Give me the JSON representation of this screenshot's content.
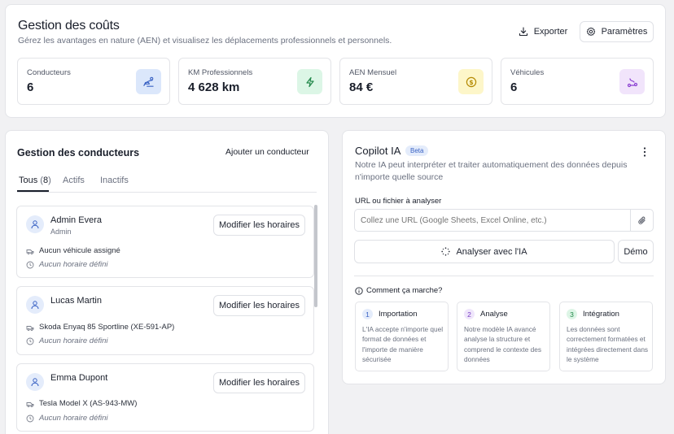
{
  "header": {
    "title": "Gestion des coûts",
    "subtitle": "Gérez les avantages en nature (AEN) et visualisez les déplacements professionnels et personnels.",
    "export_label": "Exporter",
    "settings_label": "Paramètres"
  },
  "stats": [
    {
      "label": "Conducteurs",
      "value": "6",
      "icon": "steering-wheel-icon",
      "color": "#dbe7fb"
    },
    {
      "label": "KM Professionnels",
      "value": "4 628 km",
      "icon": "lightning-icon",
      "color": "#dcf6e6"
    },
    {
      "label": "AEN Mensuel",
      "value": "84 €",
      "icon": "coin-icon",
      "color": "#fdf6c9"
    },
    {
      "label": "Véhicules",
      "value": "6",
      "icon": "route-icon",
      "color": "#f1e4fb"
    }
  ],
  "drivers_panel": {
    "title": "Gestion des conducteurs",
    "add_label": "Ajouter un conducteur",
    "tabs": [
      {
        "label": "Tous",
        "count": "8"
      },
      {
        "label": "Actifs"
      },
      {
        "label": "Inactifs"
      }
    ],
    "modify_label": "Modifier les horaires",
    "drivers": [
      {
        "name": "Admin Evera",
        "role": "Admin",
        "vehicle": "Aucun véhicule assigné",
        "schedule": "Aucun horaire défini"
      },
      {
        "name": "Lucas Martin",
        "vehicle": "Skoda Enyaq 85 Sportline (XE-591-AP)",
        "schedule": "Aucun horaire défini"
      },
      {
        "name": "Emma Dupont",
        "vehicle": "Tesla Model X (AS-943-MW)",
        "schedule": "Aucun horaire défini"
      }
    ]
  },
  "copilot": {
    "title": "Copilot IA",
    "badge": "Beta",
    "description": "Notre IA peut interpréter et traiter automatiquement des données depuis n'importe quelle source",
    "field_label": "URL ou fichier à analyser",
    "placeholder": "Collez une URL (Google Sheets, Excel Online, etc.)",
    "analyze_label": "Analyser avec l'IA",
    "demo_label": "Démo",
    "how_label": "Comment ça marche?",
    "steps": [
      {
        "num": "1",
        "title": "Importation",
        "desc": "L'IA accepte n'importe quel format de données et l'importe de manière sécurisée",
        "color": "#e4ecfb",
        "text_color": "#3b63c4"
      },
      {
        "num": "2",
        "title": "Analyse",
        "desc": "Notre modèle IA avancé analyse la structure et comprend le contexte des données",
        "color": "#efe6fb",
        "text_color": "#7a3fc4"
      },
      {
        "num": "3",
        "title": "Intégration",
        "desc": "Les données sont correctement formatées et intégrées directement dans le système",
        "color": "#ddf5e6",
        "text_color": "#22884a"
      }
    ]
  }
}
